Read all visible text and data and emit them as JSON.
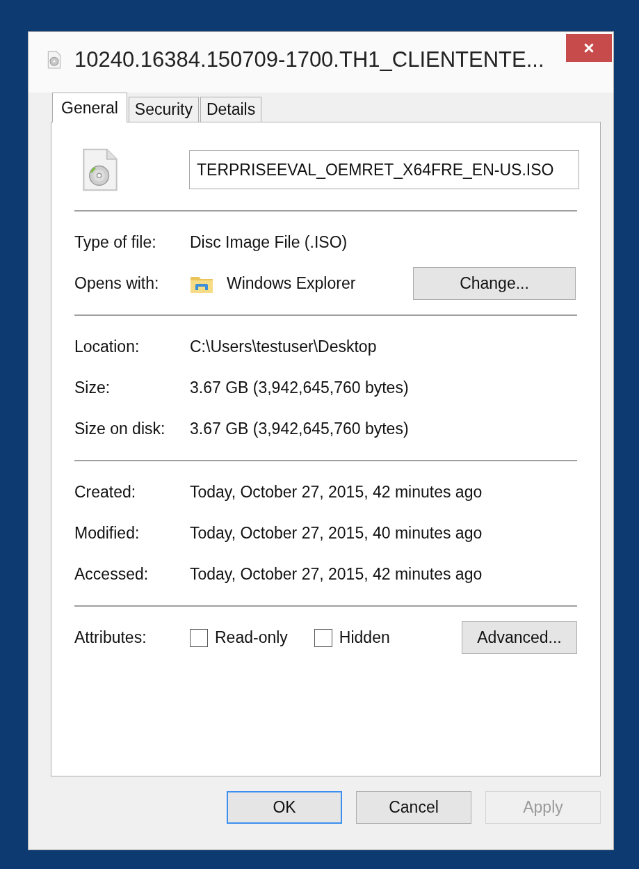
{
  "window": {
    "title": "10240.16384.150709-1700.TH1_CLIENTENTE..."
  },
  "tabs": [
    {
      "label": "General",
      "selected": true
    },
    {
      "label": "Security",
      "selected": false
    },
    {
      "label": "Details",
      "selected": false
    }
  ],
  "file_name": {
    "value": "TERPRISEEVAL_OEMRET_X64FRE_EN-US.ISO"
  },
  "sections": [
    [
      {
        "kind": "text",
        "label": "Type of file:",
        "value": "Disc Image File (.ISO)"
      },
      {
        "kind": "app",
        "label": "Opens with:",
        "value": "Windows Explorer",
        "button": "Change..."
      }
    ],
    [
      {
        "kind": "text",
        "label": "Location:",
        "value": "C:\\Users\\testuser\\Desktop"
      },
      {
        "kind": "text",
        "label": "Size:",
        "value": "3.67 GB (3,942,645,760 bytes)"
      },
      {
        "kind": "text",
        "label": "Size on disk:",
        "value": "3.67 GB (3,942,645,760 bytes)"
      }
    ],
    [
      {
        "kind": "text",
        "label": "Created:",
        "value": "Today, October 27, 2015, 42 minutes ago"
      },
      {
        "kind": "text",
        "label": "Modified:",
        "value": "Today, October 27, 2015, 40 minutes ago"
      },
      {
        "kind": "text",
        "label": "Accessed:",
        "value": "Today, October 27, 2015, 42 minutes ago"
      }
    ],
    [
      {
        "kind": "attributes",
        "label": "Attributes:",
        "options": [
          {
            "label": "Read-only",
            "checked": false
          },
          {
            "label": "Hidden",
            "checked": false
          }
        ],
        "button": "Advanced..."
      }
    ]
  ],
  "buttons": [
    {
      "label": "OK",
      "default": true,
      "disabled": false
    },
    {
      "label": "Cancel",
      "default": false,
      "disabled": false
    },
    {
      "label": "Apply",
      "default": false,
      "disabled": true
    }
  ]
}
